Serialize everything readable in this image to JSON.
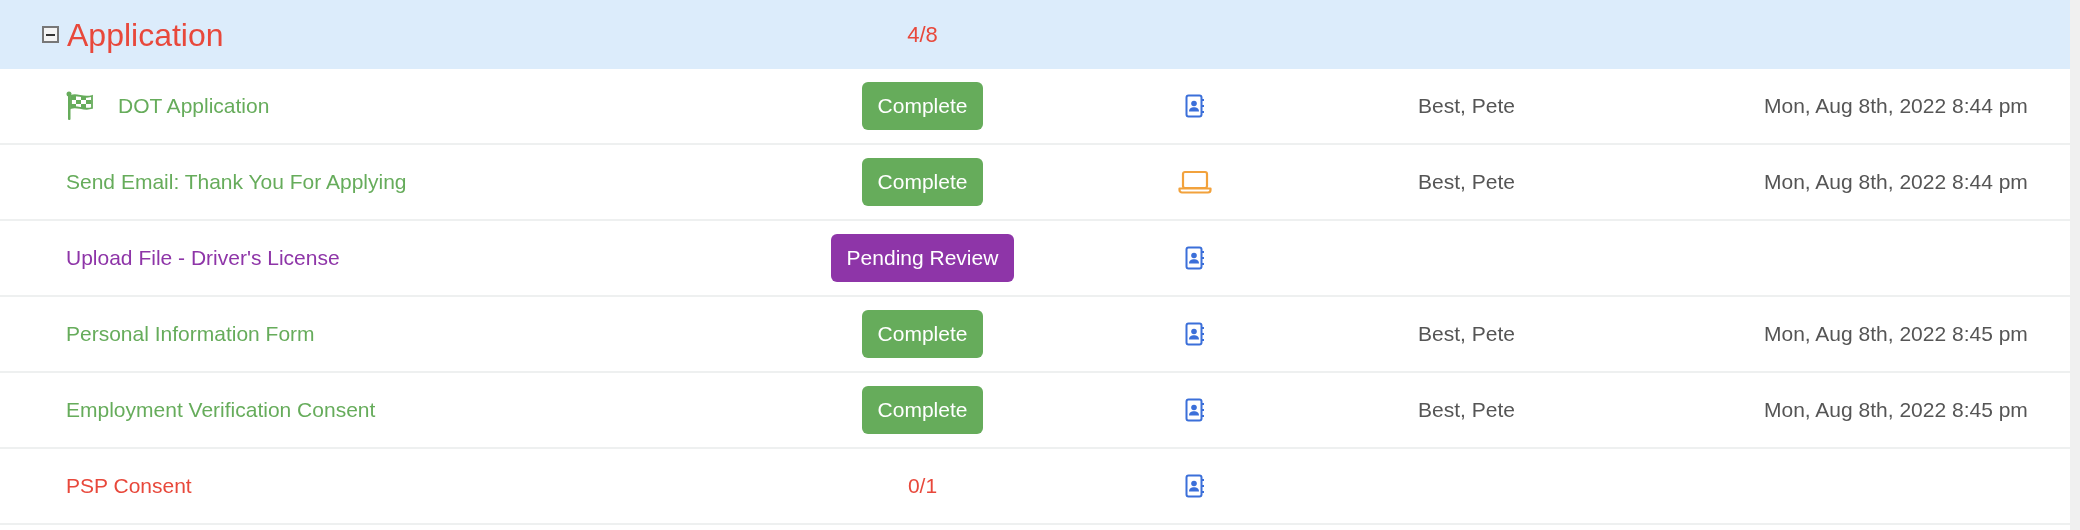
{
  "group": {
    "title": "Application",
    "expanded": true,
    "progress": "4/8"
  },
  "rows": [
    {
      "name": "DOT Application",
      "flagged": true,
      "status": {
        "kind": "badge",
        "label": "Complete",
        "color": "#66ac5b"
      },
      "source": {
        "kind": "form"
      },
      "person": "Best, Pete",
      "date": "Mon, Aug 8th, 2022 8:44 pm"
    },
    {
      "name": "Send Email: Thank You For Applying",
      "flagged": false,
      "status": {
        "kind": "badge",
        "label": "Complete",
        "color": "#66ac5b"
      },
      "source": {
        "kind": "email"
      },
      "person": "Best, Pete",
      "date": "Mon, Aug 8th, 2022 8:44 pm"
    },
    {
      "name": "Upload File - Driver's License",
      "flagged": false,
      "status": {
        "kind": "badge",
        "label": "Pending Review",
        "color": "#8e35a8"
      },
      "source": {
        "kind": "form"
      }
    },
    {
      "name": "Personal Information Form",
      "flagged": false,
      "status": {
        "kind": "badge",
        "label": "Complete",
        "color": "#66ac5b"
      },
      "source": {
        "kind": "form"
      },
      "person": "Best, Pete",
      "date": "Mon, Aug 8th, 2022 8:45 pm"
    },
    {
      "name": "Employment Verification Consent",
      "flagged": false,
      "status": {
        "kind": "badge",
        "label": "Complete",
        "color": "#66ac5b"
      },
      "source": {
        "kind": "form"
      },
      "person": "Best, Pete",
      "date": "Mon, Aug 8th, 2022 8:45 pm"
    },
    {
      "name": "PSP Consent",
      "flagged": false,
      "status": {
        "kind": "text",
        "label": "0/1",
        "color": "#e8483b"
      },
      "source": {
        "kind": "form"
      }
    }
  ]
}
